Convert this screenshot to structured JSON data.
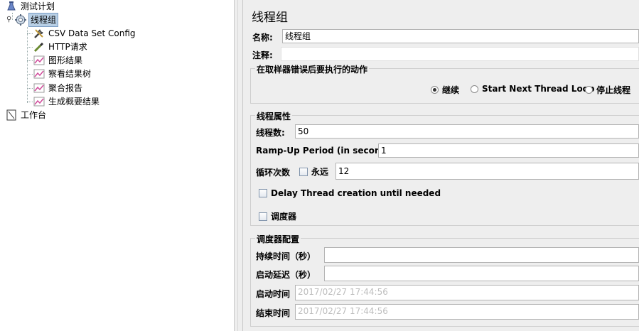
{
  "tree": {
    "test_plan": "测试计划",
    "thread_group": "线程组",
    "children": [
      {
        "label": "CSV Data Set Config",
        "icon": "wrench-icon"
      },
      {
        "label": "HTTP请求",
        "icon": "pipette-icon"
      },
      {
        "label": "图形结果",
        "icon": "chart-icon"
      },
      {
        "label": "察看结果树",
        "icon": "chart-icon"
      },
      {
        "label": "聚合报告",
        "icon": "chart-icon"
      },
      {
        "label": "生成概要结果",
        "icon": "chart-icon"
      }
    ],
    "workbench": "工作台"
  },
  "panel": {
    "title": "线程组",
    "name_label": "名称:",
    "name_value": "线程组",
    "comment_label": "注释:",
    "comment_value": "",
    "error_group": {
      "legend": "在取样器错误后要执行的动作",
      "options": [
        "继续",
        "Start Next Thread Loop",
        "停止线程"
      ],
      "selected": "继续"
    },
    "thread_props": {
      "legend": "线程属性",
      "threads_label": "线程数:",
      "threads_value": "50",
      "rampup_label": "Ramp-Up Period (in seconds):",
      "rampup_value": "1",
      "loop_label": "循环次数",
      "forever_label": "永远",
      "loop_value": "12",
      "delay_label": "Delay Thread creation until needed",
      "scheduler_label": "调度器"
    },
    "scheduler_config": {
      "legend": "调度器配置",
      "duration_label": "持续时间（秒）",
      "duration_value": "",
      "startup_delay_label": "启动延迟（秒）",
      "startup_delay_value": "",
      "start_time_label": "启动时间",
      "start_time_value": "2017/02/27 17:44:56",
      "end_time_label": "结束时间",
      "end_time_value": "2017/02/27 17:44:56"
    }
  }
}
